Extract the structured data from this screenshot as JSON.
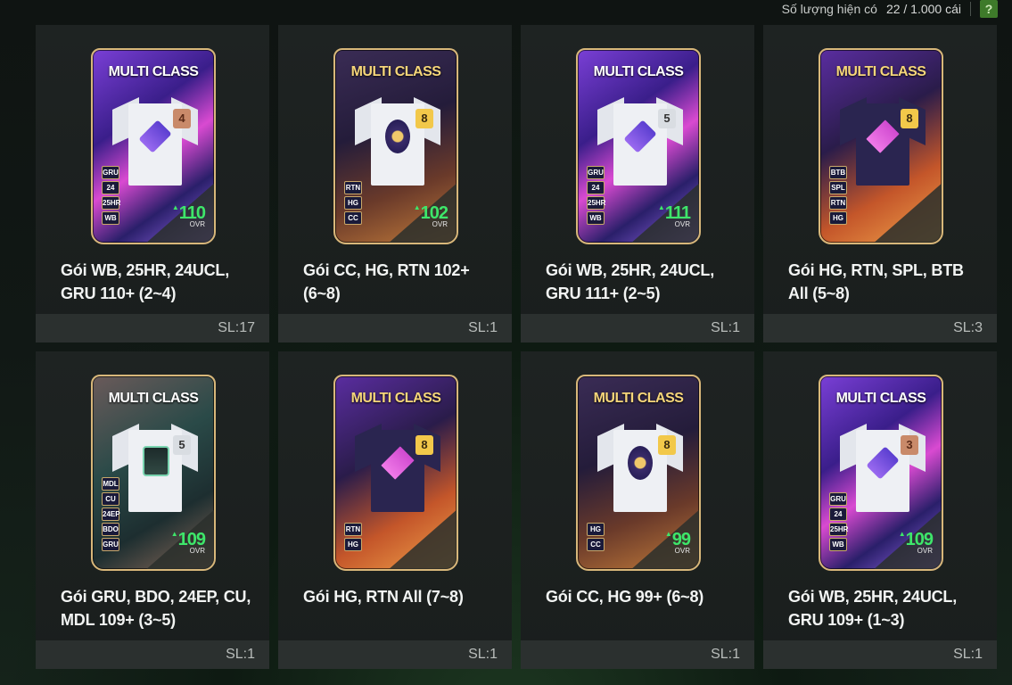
{
  "header": {
    "capacity_label": "Số lượng hiện có",
    "capacity_value": "22 / 1.000 cái",
    "help_label": "?"
  },
  "packs": [
    {
      "title": "MULTI CLASS",
      "name": "Gói WB, 25HR, 24UCL, GRU 110+ (2~4)",
      "count": "SL:17",
      "style": "purple",
      "shirt": "white",
      "emblem": "diamond",
      "level": "4",
      "level_color": "bronze",
      "badges": [
        "GRU",
        "24",
        "25HR",
        "WB"
      ],
      "ovr": "110",
      "ovr_label": "OVR"
    },
    {
      "title": "MULTI CLASS",
      "name": "Gói CC, HG, RTN 102+ (6~8)",
      "count": "SL:1",
      "style": "gold",
      "shirt": "white",
      "emblem": "round",
      "level": "8",
      "level_color": "gold",
      "badges": [
        "RTN",
        "HG",
        "CC"
      ],
      "ovr": "102",
      "ovr_label": "OVR"
    },
    {
      "title": "MULTI CLASS",
      "name": "Gói WB, 25HR, 24UCL, GRU 111+ (2~5)",
      "count": "SL:1",
      "style": "purple",
      "shirt": "white",
      "emblem": "diamond",
      "level": "5",
      "level_color": "silver",
      "badges": [
        "GRU",
        "24",
        "25HR",
        "WB"
      ],
      "ovr": "111",
      "ovr_label": "OVR"
    },
    {
      "title": "MULTI CLASS",
      "name": "Gói HG, RTN, SPL, BTB All (5~8)",
      "count": "SL:3",
      "style": "orange",
      "shirt": "dark",
      "emblem": "diamond",
      "level": "8",
      "level_color": "gold",
      "badges": [
        "BTB",
        "SPL",
        "RTN",
        "HG"
      ],
      "ovr": "",
      "ovr_label": ""
    },
    {
      "title": "MULTI CLASS",
      "name": "Gói GRU, BDO, 24EP, CU, MDL 109+ (3~5)",
      "count": "SL:1",
      "style": "teal",
      "shirt": "white",
      "emblem": "cube",
      "level": "5",
      "level_color": "silver",
      "badges": [
        "MDL",
        "CU",
        "24EP",
        "BDO",
        "GRU"
      ],
      "ovr": "109",
      "ovr_label": "OVR"
    },
    {
      "title": "MULTI CLASS",
      "name": "Gói HG, RTN All (7~8)",
      "count": "SL:1",
      "style": "orange",
      "shirt": "dark",
      "emblem": "diamond",
      "level": "8",
      "level_color": "gold",
      "badges": [
        "RTN",
        "HG"
      ],
      "ovr": "",
      "ovr_label": ""
    },
    {
      "title": "MULTI CLASS",
      "name": "Gói CC, HG 99+ (6~8)",
      "count": "SL:1",
      "style": "gold",
      "shirt": "white",
      "emblem": "round",
      "level": "8",
      "level_color": "gold",
      "badges": [
        "HG",
        "CC"
      ],
      "ovr": "99",
      "ovr_label": "OVR"
    },
    {
      "title": "MULTI CLASS",
      "name": "Gói WB, 25HR, 24UCL, GRU 109+ (1~3)",
      "count": "SL:1",
      "style": "purple",
      "shirt": "white",
      "emblem": "diamond",
      "level": "3",
      "level_color": "bronze",
      "badges": [
        "GRU",
        "24",
        "25HR",
        "WB"
      ],
      "ovr": "109",
      "ovr_label": "OVR"
    }
  ]
}
